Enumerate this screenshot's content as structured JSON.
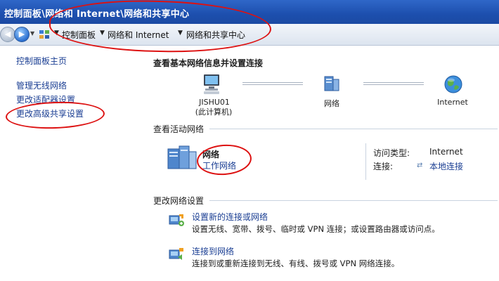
{
  "window": {
    "title": "控制面板\\网络和 Internet\\网络和共享中心"
  },
  "address_bar": {
    "crumbs": [
      "控制面板",
      "网络和 Internet",
      "网络和共享中心"
    ],
    "icons": {
      "back": "back-arrow-icon",
      "forward": "forward-arrow-icon",
      "location": "control-panel-icon"
    }
  },
  "sidebar": {
    "items": [
      {
        "label": "控制面板主页"
      },
      {
        "label": "管理无线网络"
      },
      {
        "label": "更改适配器设置"
      },
      {
        "label": "更改高级共享设置"
      }
    ]
  },
  "main": {
    "heading": "查看基本网络信息并设置连接",
    "map": {
      "computer_name": "JISHU01",
      "computer_sub": "(此计算机)",
      "network_label": "网络",
      "internet_label": "Internet"
    },
    "active": {
      "section_title": "查看活动网络",
      "network_name": "网络",
      "network_type": "工作网络",
      "access_type_label": "访问类型:",
      "access_type_value": "Internet",
      "connections_label": "连接:",
      "connections_value": "本地连接"
    },
    "change": {
      "section_title": "更改网络设置",
      "tasks": [
        {
          "title": "设置新的连接或网络",
          "desc": "设置无线、宽带、拨号、临时或 VPN 连接；或设置路由器或访问点。"
        },
        {
          "title": "连接到网络",
          "desc": "连接到或重新连接到无线、有线、拨号或 VPN 网络连接。"
        }
      ]
    }
  },
  "colors": {
    "link": "#1a3e93",
    "titlebar": "#1d4fae",
    "annotation": "#dd1111"
  }
}
